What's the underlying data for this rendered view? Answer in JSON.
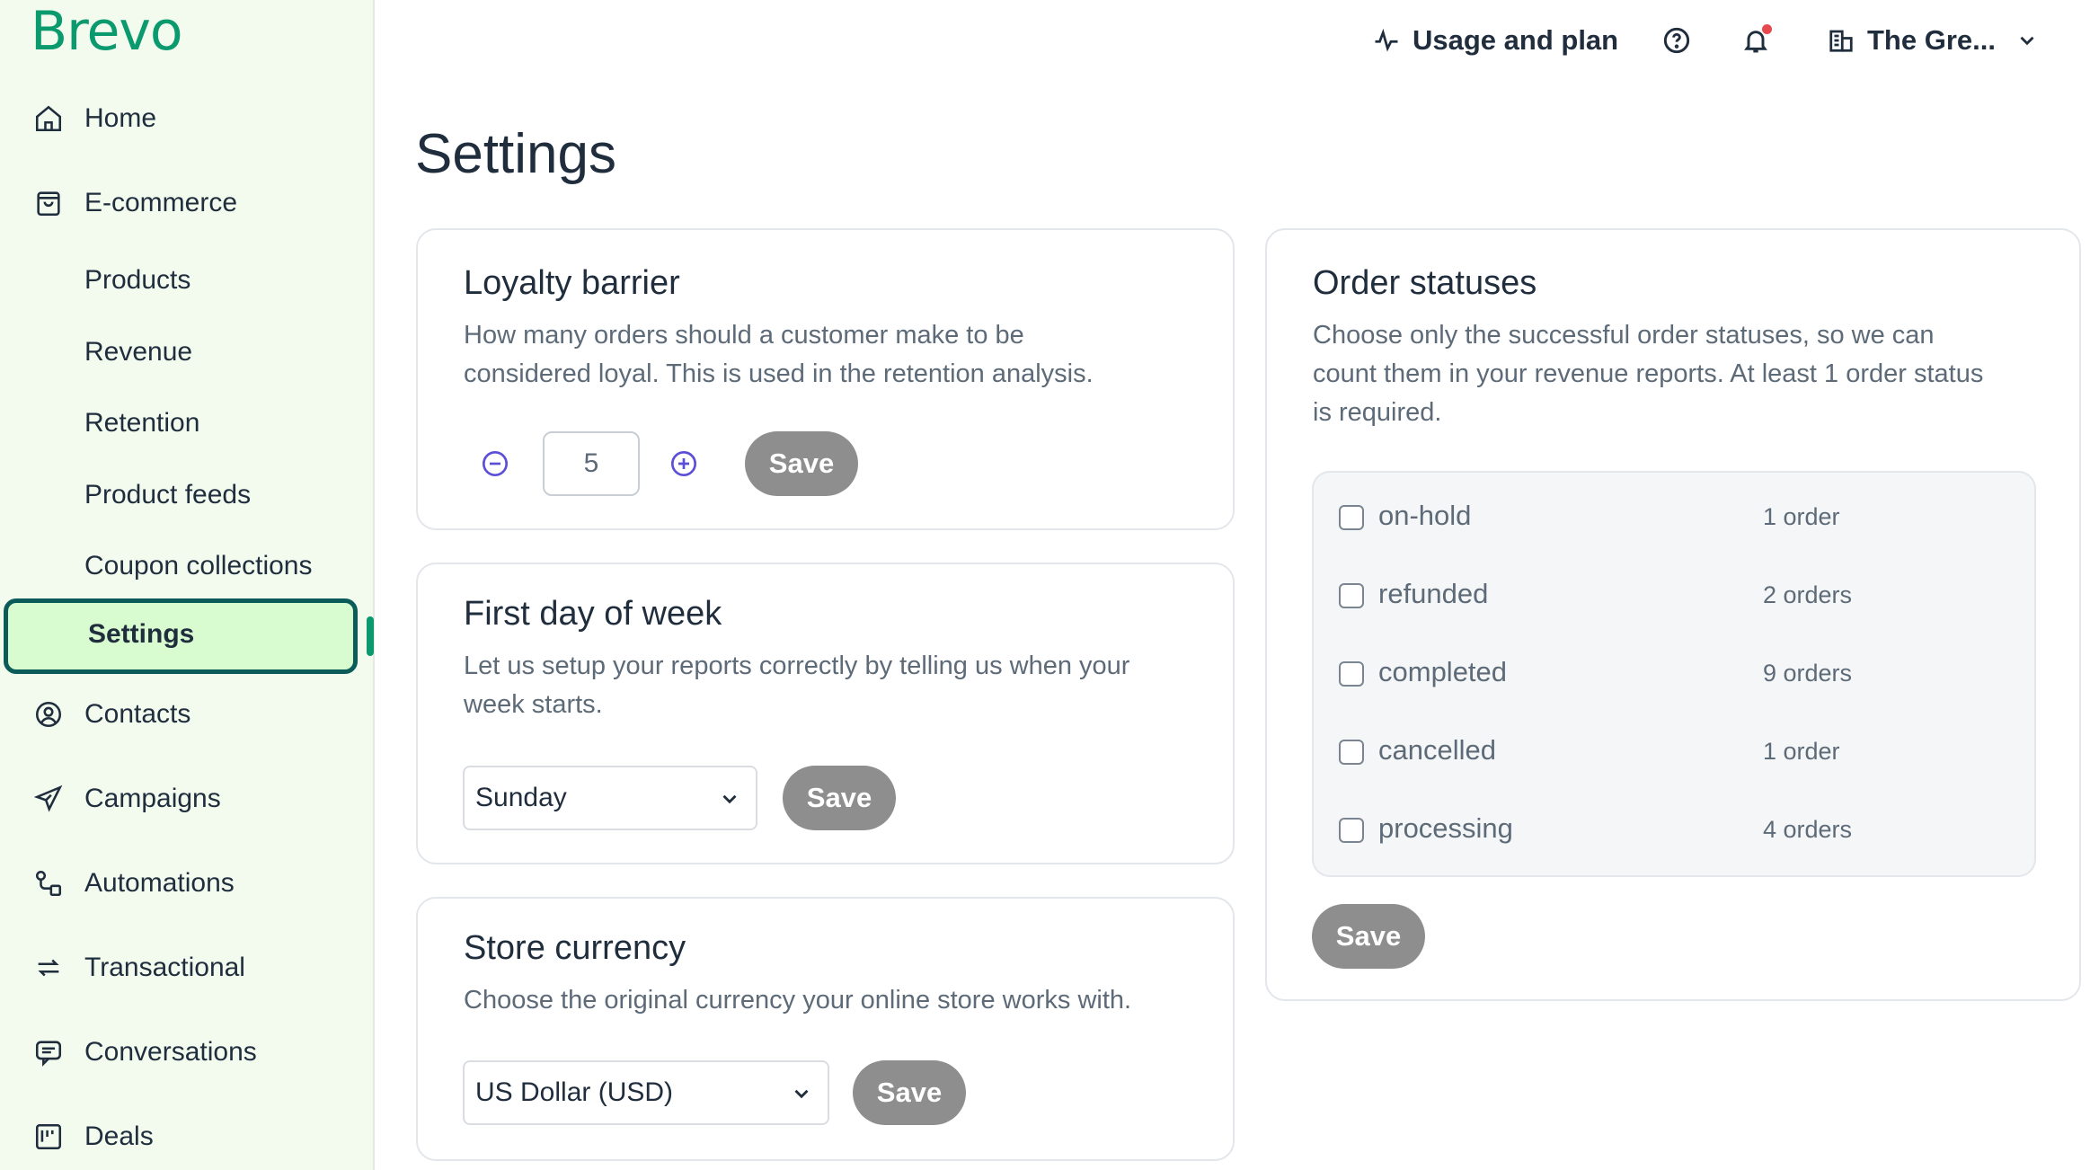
{
  "brand": {
    "logo_text": "Brevo",
    "accent": "#0b996e"
  },
  "sidebar": {
    "items": [
      {
        "label": "Home",
        "icon": "home-icon"
      },
      {
        "label": "E-commerce",
        "icon": "shopping-bag-icon"
      },
      {
        "label": "Products"
      },
      {
        "label": "Revenue"
      },
      {
        "label": "Retention"
      },
      {
        "label": "Product feeds"
      },
      {
        "label": "Coupon collections"
      },
      {
        "label": "Settings",
        "active": true
      },
      {
        "label": "Contacts",
        "icon": "contact-icon"
      },
      {
        "label": "Campaigns",
        "icon": "send-icon"
      },
      {
        "label": "Automations",
        "icon": "automation-icon"
      },
      {
        "label": "Transactional",
        "icon": "transactional-icon"
      },
      {
        "label": "Conversations",
        "icon": "chat-icon"
      },
      {
        "label": "Deals",
        "icon": "deals-icon"
      }
    ]
  },
  "topbar": {
    "usage_label": "Usage and plan",
    "account_label": "The Gre...",
    "icons": [
      "activity-icon",
      "help-icon",
      "bell-icon",
      "building-icon",
      "chevron-down-icon"
    ]
  },
  "page": {
    "title": "Settings"
  },
  "loyalty": {
    "title": "Loyalty barrier",
    "description_line1": "How many orders should a customer make to be",
    "description_line2": "considered loyal. This is used in the retention analysis.",
    "value": "5",
    "save_label": "Save"
  },
  "week": {
    "title": "First day of week",
    "description_line1": "Let us setup your reports correctly by telling us when your",
    "description_line2": "week starts.",
    "selected": "Sunday",
    "save_label": "Save"
  },
  "currency": {
    "title": "Store currency",
    "description": "Choose the original currency your online store works with.",
    "selected": "US Dollar (USD)",
    "save_label": "Save"
  },
  "orders": {
    "title": "Order statuses",
    "description_line1": "Choose only the successful order statuses, so we can",
    "description_line2": "count them in your revenue reports. At least 1 order status",
    "description_line3": "is required.",
    "statuses": [
      {
        "label": "on-hold",
        "count": "1 order"
      },
      {
        "label": "refunded",
        "count": "2 orders"
      },
      {
        "label": "completed",
        "count": "9 orders"
      },
      {
        "label": "cancelled",
        "count": "1 order"
      },
      {
        "label": "processing",
        "count": "4 orders"
      }
    ],
    "save_label": "Save"
  }
}
